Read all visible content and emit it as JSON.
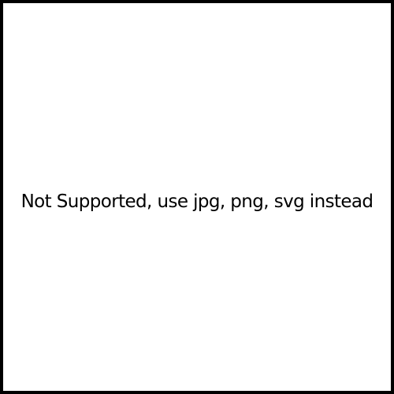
{
  "message": {
    "text": "Not Supported, use jpg, png, svg instead"
  },
  "colors": {
    "background": "#ffffff",
    "border": "#000000",
    "text": "#000000"
  }
}
